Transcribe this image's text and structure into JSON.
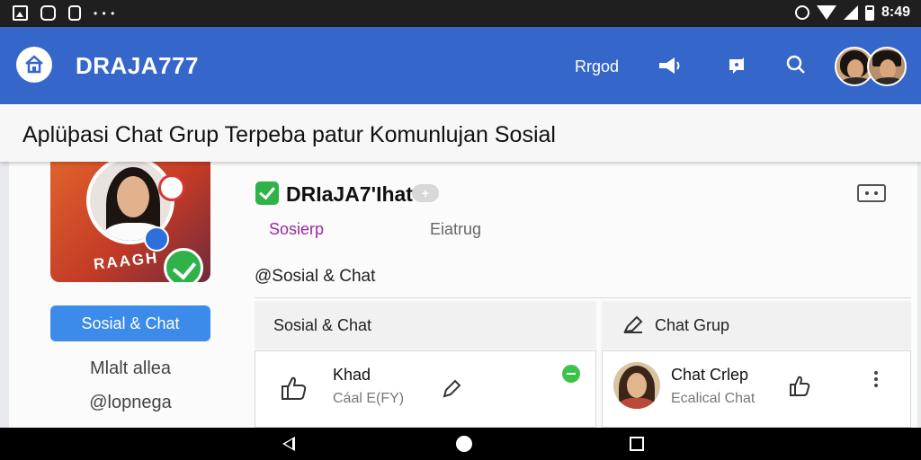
{
  "status_bar": {
    "time": "8:49",
    "left_icons": [
      "image-icon",
      "cloud-icon",
      "lock-icon",
      "dots-icon"
    ],
    "right_icons": [
      "sync-icon",
      "wifi-icon",
      "signal-icon",
      "battery-icon"
    ]
  },
  "app_bar": {
    "title": "DRAJA777",
    "link_label": "Rrgod",
    "icons": [
      "home-icon",
      "megaphone-icon",
      "notification-icon",
      "search-icon"
    ],
    "accent_color": "#3566c9"
  },
  "banner": {
    "text": "Aplüþasi Chat Grup Terpeba patur Komunlujan Sosial"
  },
  "profile": {
    "image_word": "RAAGH",
    "title": "DRIaJA7'Ihat",
    "badge_text": "+",
    "tabs": [
      "Sosierp",
      "Eiatrug"
    ],
    "section_label": "@Sosial & Chat"
  },
  "sidebar": {
    "button_label": "Sosial & Chat",
    "name": "Mlalt allea",
    "handle": "@lopnega"
  },
  "panels": {
    "left": {
      "header": "Sosial & Chat",
      "card_title": "Khad",
      "card_sub": "Cáal E(FY)"
    },
    "right": {
      "header": "Chat Grup",
      "card_title": "Chat Crlep",
      "card_sub": "Ecalical Chat"
    }
  },
  "colors": {
    "button_blue": "#3c8bea",
    "check_green": "#2fb24a",
    "tab_purple": "#9c2aa0"
  }
}
